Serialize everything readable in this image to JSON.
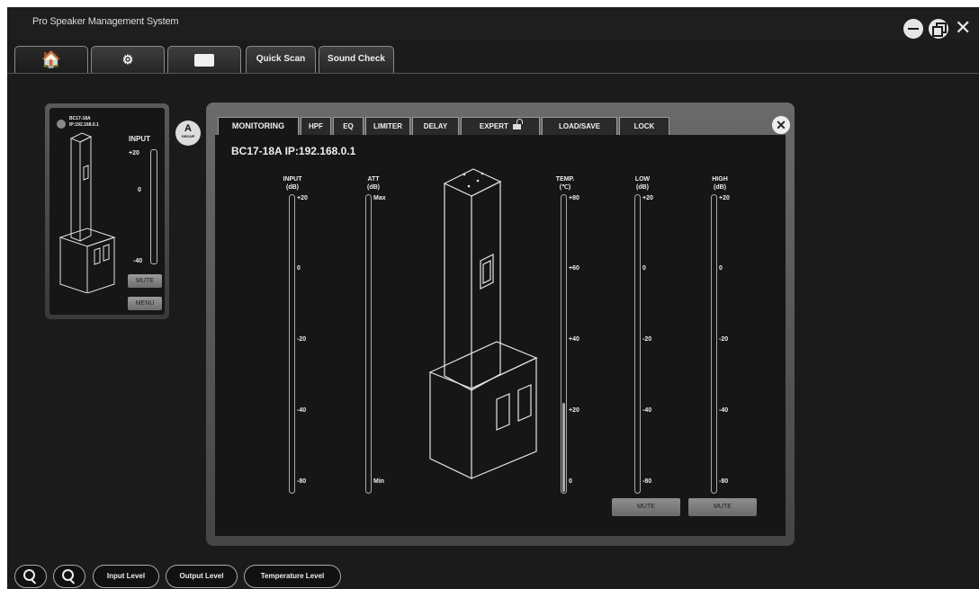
{
  "app": {
    "title": "Pro Speaker Management System"
  },
  "window_controls": {
    "minimize_icon": "minimize-icon",
    "restore_icon": "restore-icon",
    "close_icon": "close-icon",
    "close_glyph": "✕"
  },
  "top_tabs": [
    {
      "icon": "home-icon",
      "glyph": "🏠",
      "active": true
    },
    {
      "icon": "gear-icon",
      "glyph": "⚙"
    },
    {
      "icon": "device-icon"
    },
    {
      "label": "Quick Scan"
    },
    {
      "label": "Sound Check"
    }
  ],
  "device_card": {
    "model": "BC17-18A",
    "ip": "IP:192.168.0.1",
    "input_label": "INPUT",
    "meter_ticks": [
      "+20",
      "0",
      "-40"
    ],
    "mute_label": "MUTE",
    "menu_label": "MENU",
    "group_letter": "A",
    "group_label": "GROUP"
  },
  "panel": {
    "tabs": [
      "MONITORING",
      "HPF",
      "EQ",
      "LIMITER",
      "DELAY",
      "EXPERT",
      "LOAD/SAVE",
      "LOCK"
    ],
    "active_tab": "MONITORING",
    "device_header": "BC17-18A IP:192.168.0.1",
    "close_glyph": "✕",
    "meters": {
      "input": {
        "label": "INPUT",
        "unit": "(dB)",
        "ticks": [
          "+20",
          "0",
          "-20",
          "-40",
          "-80"
        ]
      },
      "att": {
        "label": "ATT",
        "unit": "(dB)",
        "ticks": [
          "Max",
          "Min"
        ]
      },
      "temp": {
        "label": "TEMP.",
        "unit": "(℃)",
        "ticks": [
          "+80",
          "+60",
          "+40",
          "+20",
          "0"
        ],
        "level_fraction": 0.3
      },
      "low": {
        "label": "LOW",
        "unit": "(dB)",
        "ticks": [
          "+20",
          "0",
          "-20",
          "-40",
          "-80"
        ]
      },
      "high": {
        "label": "HIGH",
        "unit": "(dB)",
        "ticks": [
          "+20",
          "0",
          "-20",
          "-40",
          "-80"
        ]
      }
    },
    "low_mute": "MUTE",
    "high_mute": "MUTE"
  },
  "bottom_bar": {
    "zoom_in_icon": "zoom-in-icon",
    "zoom_out_icon": "zoom-out-icon",
    "input_level": "Input Level",
    "output_level": "Output Level",
    "temperature_level": "Temperature Level"
  }
}
